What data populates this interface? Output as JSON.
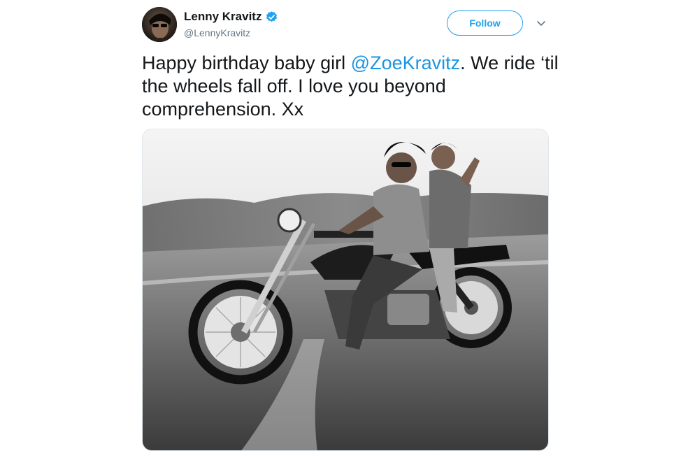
{
  "tweet": {
    "author": {
      "display_name": "Lenny Kravitz",
      "handle": "@LennyKravitz",
      "verified": true,
      "avatar_icon": "avatar-photo"
    },
    "follow_label": "Follow",
    "caret_icon": "chevron-down-icon",
    "text": {
      "before": "Happy birthday baby girl ",
      "mention": "@ZoeKravitz",
      "after": ". We ride ‘til the wheels fall off. I love you beyond comprehension. Xx"
    },
    "media": {
      "kind": "photo",
      "description_icon": "motorcycle-photo"
    }
  },
  "colors": {
    "accent": "#1da1f2",
    "link": "#1b95e0",
    "text": "#14171a",
    "secondary": "#657786"
  }
}
